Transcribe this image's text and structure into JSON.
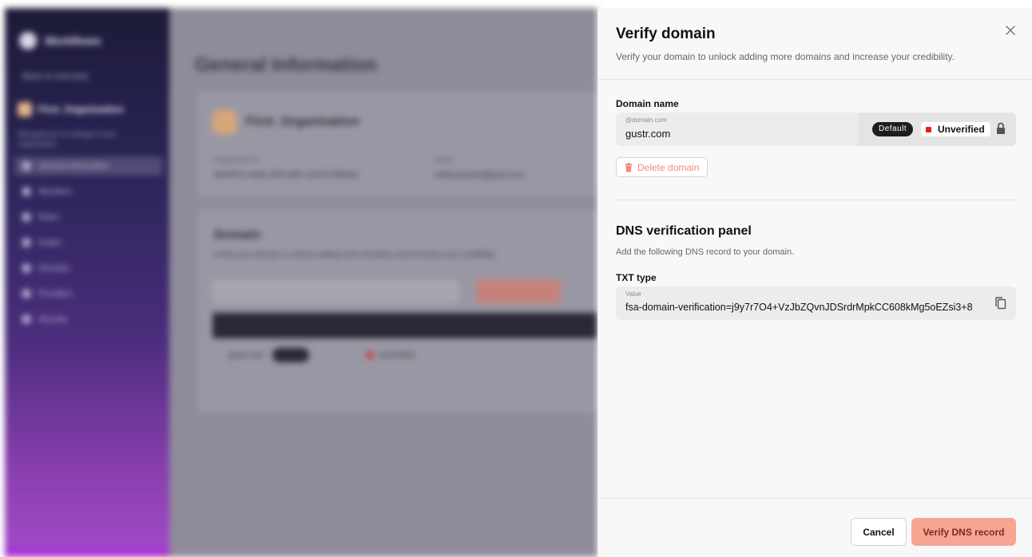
{
  "background": {
    "sidebar": {
      "logo_text": "Workflows",
      "back_link": "Back to overview",
      "org_name": "First_Organisation",
      "org_sub": "Management & settings of your organisation",
      "items": [
        {
          "label": "General Information"
        },
        {
          "label": "Members"
        },
        {
          "label": "Roles"
        },
        {
          "label": "Invites"
        },
        {
          "label": "Domains"
        },
        {
          "label": "Providers"
        },
        {
          "label": "Security"
        }
      ]
    },
    "main": {
      "page_title": "General Information",
      "org_card": {
        "name": "First_Organisation",
        "id_label": "Organisation ID",
        "id_value": "6b0cf07e-8a6e-4f2f-a9b1-ae37b70f0bbd",
        "owner_label": "Owner",
        "owner_value": "ashley.bryant@gustr.com"
      },
      "domain_card": {
        "title": "Domain",
        "description": "Verify your domain to unlock adding more domains and increase your credibility.",
        "search_placeholder": "Search domain",
        "add_button": "Add domain",
        "row_domain": "gustr.com",
        "row_badge": "Default",
        "row_status": "Unverified"
      }
    }
  },
  "drawer": {
    "title": "Verify domain",
    "subtitle": "Verify your domain to unlock adding more domains and increase your credibility.",
    "domain_section": {
      "label": "Domain name",
      "mini_label": "@domain.com",
      "value": "gustr.com",
      "default_badge": "Default",
      "status": "Unverified",
      "status_color": "#e02424"
    },
    "delete_button": "Delete domain",
    "dns_panel": {
      "title": "DNS verification panel",
      "description": "Add the following DNS record to your domain.",
      "record_type_label": "TXT type",
      "value_mini_label": "Value",
      "value": "fsa-domain-verification=j9y7r7O4+VzJbZQvnJDSrdrMpkCC608kMg5oEZsi3+8"
    },
    "footer": {
      "cancel_button": "Cancel",
      "verify_button": "Verify DNS record"
    }
  },
  "colors": {
    "accent": "#f5a592",
    "danger": "#f08a7a",
    "status_unverified": "#e02424",
    "badge_default_bg": "#1d1d1f"
  },
  "icons": {
    "close": "close-icon",
    "lock": "lock-icon",
    "trash": "trash-icon",
    "copy": "copy-icon"
  }
}
